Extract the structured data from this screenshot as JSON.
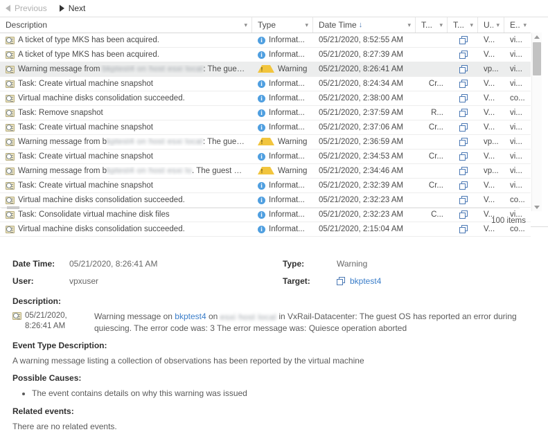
{
  "nav": {
    "previous_label": "Previous",
    "next_label": "Next",
    "previous_icon": "triangle-left-icon",
    "next_icon": "triangle-right-icon"
  },
  "table": {
    "columns": [
      {
        "key": "description",
        "label": "Description",
        "sorted": false
      },
      {
        "key": "type",
        "label": "Type",
        "sorted": false
      },
      {
        "key": "date_time",
        "label": "Date Time",
        "sorted": true,
        "sort_arrow": "↓"
      },
      {
        "key": "task",
        "label": "T...",
        "sorted": false
      },
      {
        "key": "target",
        "label": "T...",
        "sorted": false
      },
      {
        "key": "user",
        "label": "U...",
        "sorted": false
      },
      {
        "key": "event",
        "label": "E...",
        "sorted": false
      }
    ],
    "rows": [
      {
        "description": "A ticket of type MKS has been acquired.",
        "redacted": false,
        "type": "Informat...",
        "type_icon": "info-icon",
        "date_time": "05/21/2020, 8:52:55 AM",
        "task": "",
        "target_icon": "vm-icon",
        "user": "V...",
        "event": "vi...",
        "selected": false
      },
      {
        "description": "A ticket of type MKS has been acquired.",
        "redacted": false,
        "type": "Informat...",
        "type_icon": "info-icon",
        "date_time": "05/21/2020, 8:27:39 AM",
        "task": "",
        "target_icon": "vm-icon",
        "user": "V...",
        "event": "vi...",
        "selected": false
      },
      {
        "description": "Warning message from ",
        "desc_suffix": ": The guest OS has ...",
        "redacted": true,
        "redacted_text": "bkptest4 on host esxi local",
        "type": "Warning",
        "type_icon": "warning-icon",
        "date_time": "05/21/2020, 8:26:41 AM",
        "task": "",
        "target_icon": "vm-icon",
        "user": "vp...",
        "event": "vi...",
        "selected": true
      },
      {
        "description": "Task: Create virtual machine snapshot",
        "redacted": false,
        "type": "Informat...",
        "type_icon": "info-icon",
        "date_time": "05/21/2020, 8:24:34 AM",
        "task": "Cr...",
        "target_icon": "vm-icon",
        "user": "V...",
        "event": "vi...",
        "selected": false
      },
      {
        "description": "Virtual machine disks consolidation succeeded.",
        "redacted": false,
        "type": "Informat...",
        "type_icon": "info-icon",
        "date_time": "05/21/2020, 2:38:00 AM",
        "task": "",
        "target_icon": "vm-icon",
        "user": "V...",
        "event": "co...",
        "selected": false
      },
      {
        "description": "Task: Remove snapshot",
        "redacted": false,
        "type": "Informat...",
        "type_icon": "info-icon",
        "date_time": "05/21/2020, 2:37:59 AM",
        "task": "R...",
        "target_icon": "vm-icon",
        "user": "V...",
        "event": "vi...",
        "selected": false
      },
      {
        "description": "Task: Create virtual machine snapshot",
        "redacted": false,
        "type": "Informat...",
        "type_icon": "info-icon",
        "date_time": "05/21/2020, 2:37:06 AM",
        "task": "Cr...",
        "target_icon": "vm-icon",
        "user": "V...",
        "event": "vi...",
        "selected": false
      },
      {
        "description": "Warning message from b",
        "desc_suffix": ": The guest OS has ...",
        "redacted": true,
        "redacted_text": "kptest4 on host esxi local",
        "type": "Warning",
        "type_icon": "warning-icon",
        "date_time": "05/21/2020, 2:36:59 AM",
        "task": "",
        "target_icon": "vm-icon",
        "user": "vp...",
        "event": "vi...",
        "selected": false
      },
      {
        "description": "Task: Create virtual machine snapshot",
        "redacted": false,
        "type": "Informat...",
        "type_icon": "info-icon",
        "date_time": "05/21/2020, 2:34:53 AM",
        "task": "Cr...",
        "target_icon": "vm-icon",
        "user": "V...",
        "event": "vi...",
        "selected": false
      },
      {
        "description": "Warning message from b",
        "desc_suffix": ". The guest OS has ...",
        "redacted": true,
        "redacted_text": "kptest4 on host esxi lo",
        "type": "Warning",
        "type_icon": "warning-icon",
        "date_time": "05/21/2020, 2:34:46 AM",
        "task": "",
        "target_icon": "vm-icon",
        "user": "vp...",
        "event": "vi...",
        "selected": false
      },
      {
        "description": "Task: Create virtual machine snapshot",
        "redacted": false,
        "type": "Informat...",
        "type_icon": "info-icon",
        "date_time": "05/21/2020, 2:32:39 AM",
        "task": "Cr...",
        "target_icon": "vm-icon",
        "user": "V...",
        "event": "vi...",
        "selected": false
      },
      {
        "description": "Virtual machine disks consolidation succeeded.",
        "redacted": false,
        "type": "Informat...",
        "type_icon": "info-icon",
        "date_time": "05/21/2020, 2:32:23 AM",
        "task": "",
        "target_icon": "vm-icon",
        "user": "V...",
        "event": "co...",
        "selected": false
      },
      {
        "description": "Task: Consolidate virtual machine disk files",
        "redacted": false,
        "type": "Informat...",
        "type_icon": "info-icon",
        "date_time": "05/21/2020, 2:32:23 AM",
        "task": "C...",
        "target_icon": "vm-icon",
        "user": "V...",
        "event": "vi...",
        "selected": false
      },
      {
        "description": "Virtual machine disks consolidation succeeded.",
        "redacted": false,
        "type": "Informat...",
        "type_icon": "info-icon",
        "date_time": "05/21/2020, 2:15:04 AM",
        "task": "",
        "target_icon": "vm-icon",
        "user": "V...",
        "event": "co...",
        "selected": false
      }
    ],
    "footer_items": "100 items"
  },
  "detail": {
    "date_time_label": "Date Time:",
    "date_time_value": "05/21/2020, 8:26:41 AM",
    "user_label": "User:",
    "user_value": "vpxuser",
    "type_label": "Type:",
    "type_value": "Warning",
    "target_label": "Target:",
    "target_value": "bkptest4",
    "target_icon": "vm-icon",
    "description_label": "Description:",
    "description_timestamp": "05/21/2020, 8:26:41 AM",
    "description_icon": "event-icon",
    "description_prefix": "Warning message on ",
    "description_link": "bkptest4",
    "description_mid": " on ",
    "description_redacted": "esxi host local",
    "description_suffix": " in VxRail-Datacenter: The guest OS has reported an error during quiescing. The error code was: 3 The error message was: Quiesce operation aborted",
    "event_type_description_label": "Event Type Description:",
    "event_type_description_value": "A warning message listing a collection of observations has been reported by the virtual machine",
    "possible_causes_label": "Possible Causes:",
    "possible_causes": [
      "The event contains details on why this warning was issued"
    ],
    "related_events_label": "Related events:",
    "related_events_value": "There are no related events."
  },
  "colors": {
    "info": "#4f9fe0",
    "warning": "#f2c53d",
    "link": "#3a7dc9",
    "selected_row": "#eceded",
    "sort_arrow": "#4a78b4"
  }
}
